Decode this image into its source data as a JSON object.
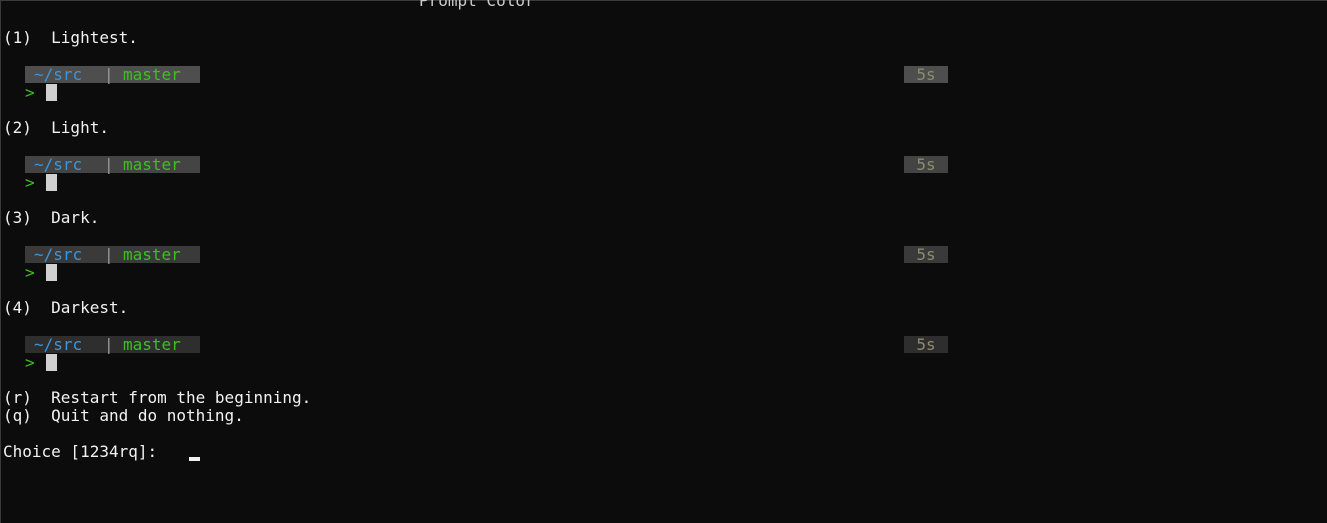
{
  "header": {
    "title": "Prompt Color"
  },
  "options": [
    {
      "label": "(1)  Lightest.",
      "dir": "~/src",
      "sep": "|",
      "branch": "master",
      "time": "5s",
      "arrow": ">"
    },
    {
      "label": "(2)  Light.",
      "dir": "~/src",
      "sep": "|",
      "branch": "master",
      "time": "5s",
      "arrow": ">"
    },
    {
      "label": "(3)  Dark.",
      "dir": "~/src",
      "sep": "|",
      "branch": "master",
      "time": "5s",
      "arrow": ">"
    },
    {
      "label": "(4)  Darkest.",
      "dir": "~/src",
      "sep": "|",
      "branch": "master",
      "time": "5s",
      "arrow": ">"
    }
  ],
  "actions": {
    "restart": "(r)  Restart from the beginning.",
    "quit": "(q)  Quit and do nothing."
  },
  "prompt": {
    "text": "Choice [1234rq]: "
  },
  "colors": {
    "background": "#0c0c0c",
    "text": "#f2f2f2",
    "dir": "#3a96dd",
    "branch": "#3cc01e",
    "lightest": "#4e4e4e",
    "light": "#444444",
    "dark": "#3a3a3a",
    "darkest": "#2e2e2e"
  }
}
